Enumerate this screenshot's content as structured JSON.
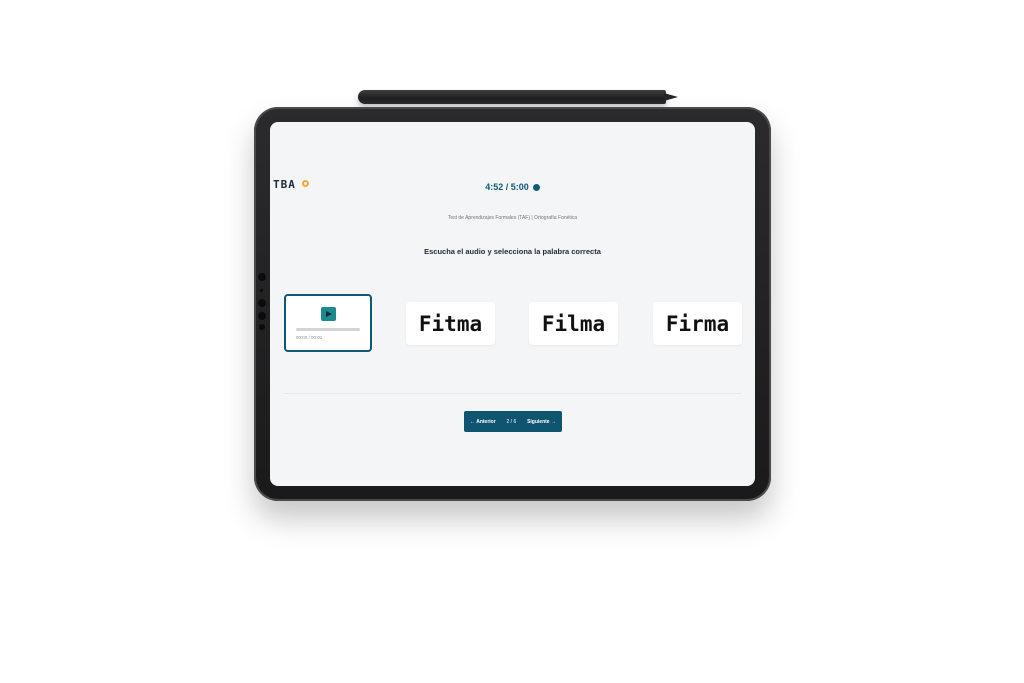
{
  "app": {
    "logo_text": "TBA",
    "timer": "4:52 / 5:00",
    "timer_icon": "stopwatch-icon",
    "subtitle": "Test de Aprendizajes Formales (TAF) | Ortografía Fonética",
    "instruction": "Escucha el audio y selecciona la palabra correcta"
  },
  "audio": {
    "play_icon": "play-icon",
    "time_label": "00:00 / 00:01"
  },
  "options": [
    "Fitma",
    "Filma",
    "Firma"
  ],
  "pager": {
    "prev_label": "← Anterior",
    "count": "2 / 6",
    "next_label": "Siguiente →"
  },
  "colors": {
    "accent": "#0f5570",
    "play": "#1b8a8c",
    "logo_accent": "#f2a93b",
    "screen_bg": "#f3f5f7"
  }
}
